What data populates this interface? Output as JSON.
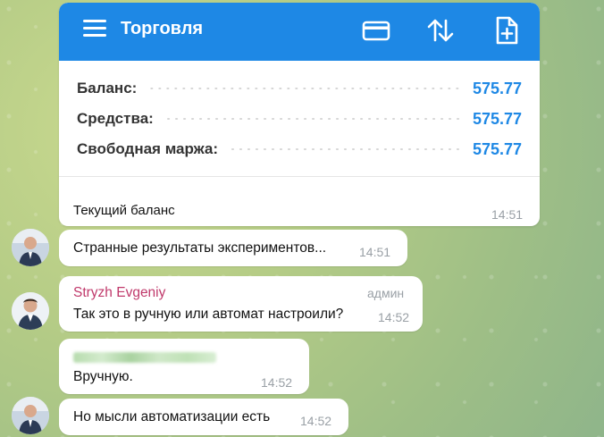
{
  "card": {
    "title": "Торговля",
    "header_color": "#1e88e5",
    "icons": [
      "menu-icon",
      "credit-card-icon",
      "sort-arrows-icon",
      "add-document-icon"
    ],
    "metrics": [
      {
        "label": "Баланс:",
        "value": "575.77"
      },
      {
        "label": "Средства:",
        "value": "575.77"
      },
      {
        "label": "Свободная маржа:",
        "value": "575.77"
      }
    ],
    "caption": "Текущий баланс",
    "time": "14:51"
  },
  "messages": [
    {
      "text": "Странные результаты экспериментов...",
      "time": "14:51"
    },
    {
      "sender": "Stryzh Evgeniy",
      "role": "админ",
      "text": "Так это в ручную или автомат настроили?",
      "time": "14:52"
    },
    {
      "text": "Вручную.",
      "time": "14:52"
    },
    {
      "text": "Но мысли автоматизации есть",
      "time": "14:52"
    }
  ]
}
